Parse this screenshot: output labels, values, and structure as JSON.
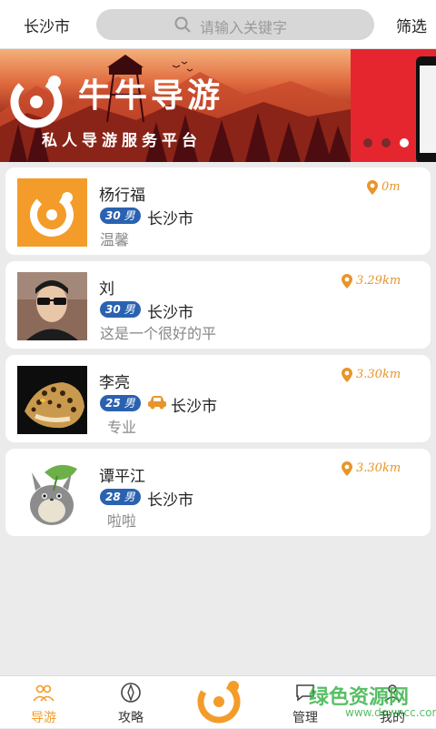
{
  "header": {
    "city": "长沙市",
    "search_placeholder": "请输入关键字",
    "filter": "筛选"
  },
  "banner": {
    "title": "牛牛导游",
    "subtitle": "私人导游服务平台",
    "dots_count": 3,
    "active_dot": 2
  },
  "guides": [
    {
      "name": "杨行福",
      "age": "30",
      "gender": "男",
      "city": "长沙市",
      "desc": "温馨",
      "distance": "0m",
      "has_car": false,
      "avatar": "app-logo"
    },
    {
      "name": "刘",
      "age": "30",
      "gender": "男",
      "city": "长沙市",
      "desc": "这是一个很好的平",
      "distance": "3.29km",
      "has_car": false,
      "avatar": "man-sunglasses"
    },
    {
      "name": "李亮",
      "age": "25",
      "gender": "男",
      "city": "长沙市",
      "desc": "专业",
      "distance": "3.30km",
      "has_car": true,
      "avatar": "leopard"
    },
    {
      "name": "谭平江",
      "age": "28",
      "gender": "男",
      "city": "长沙市",
      "desc": "啦啦",
      "distance": "3.30km",
      "has_car": false,
      "avatar": "totoro-plush"
    }
  ],
  "nav": {
    "items": [
      {
        "label": "导游",
        "icon": "people-icon",
        "active": true
      },
      {
        "label": "攻略",
        "icon": "compass-icon",
        "active": false
      },
      {
        "label": "管理",
        "icon": "chat-icon",
        "active": false
      },
      {
        "label": "我的",
        "icon": "user-icon",
        "active": false
      }
    ]
  },
  "watermark": {
    "text": "绿色资源网",
    "sub": "www.downcc.com"
  },
  "colors": {
    "accent": "#f39c2a",
    "badge": "#2a62b0",
    "distance": "#e8952a"
  }
}
